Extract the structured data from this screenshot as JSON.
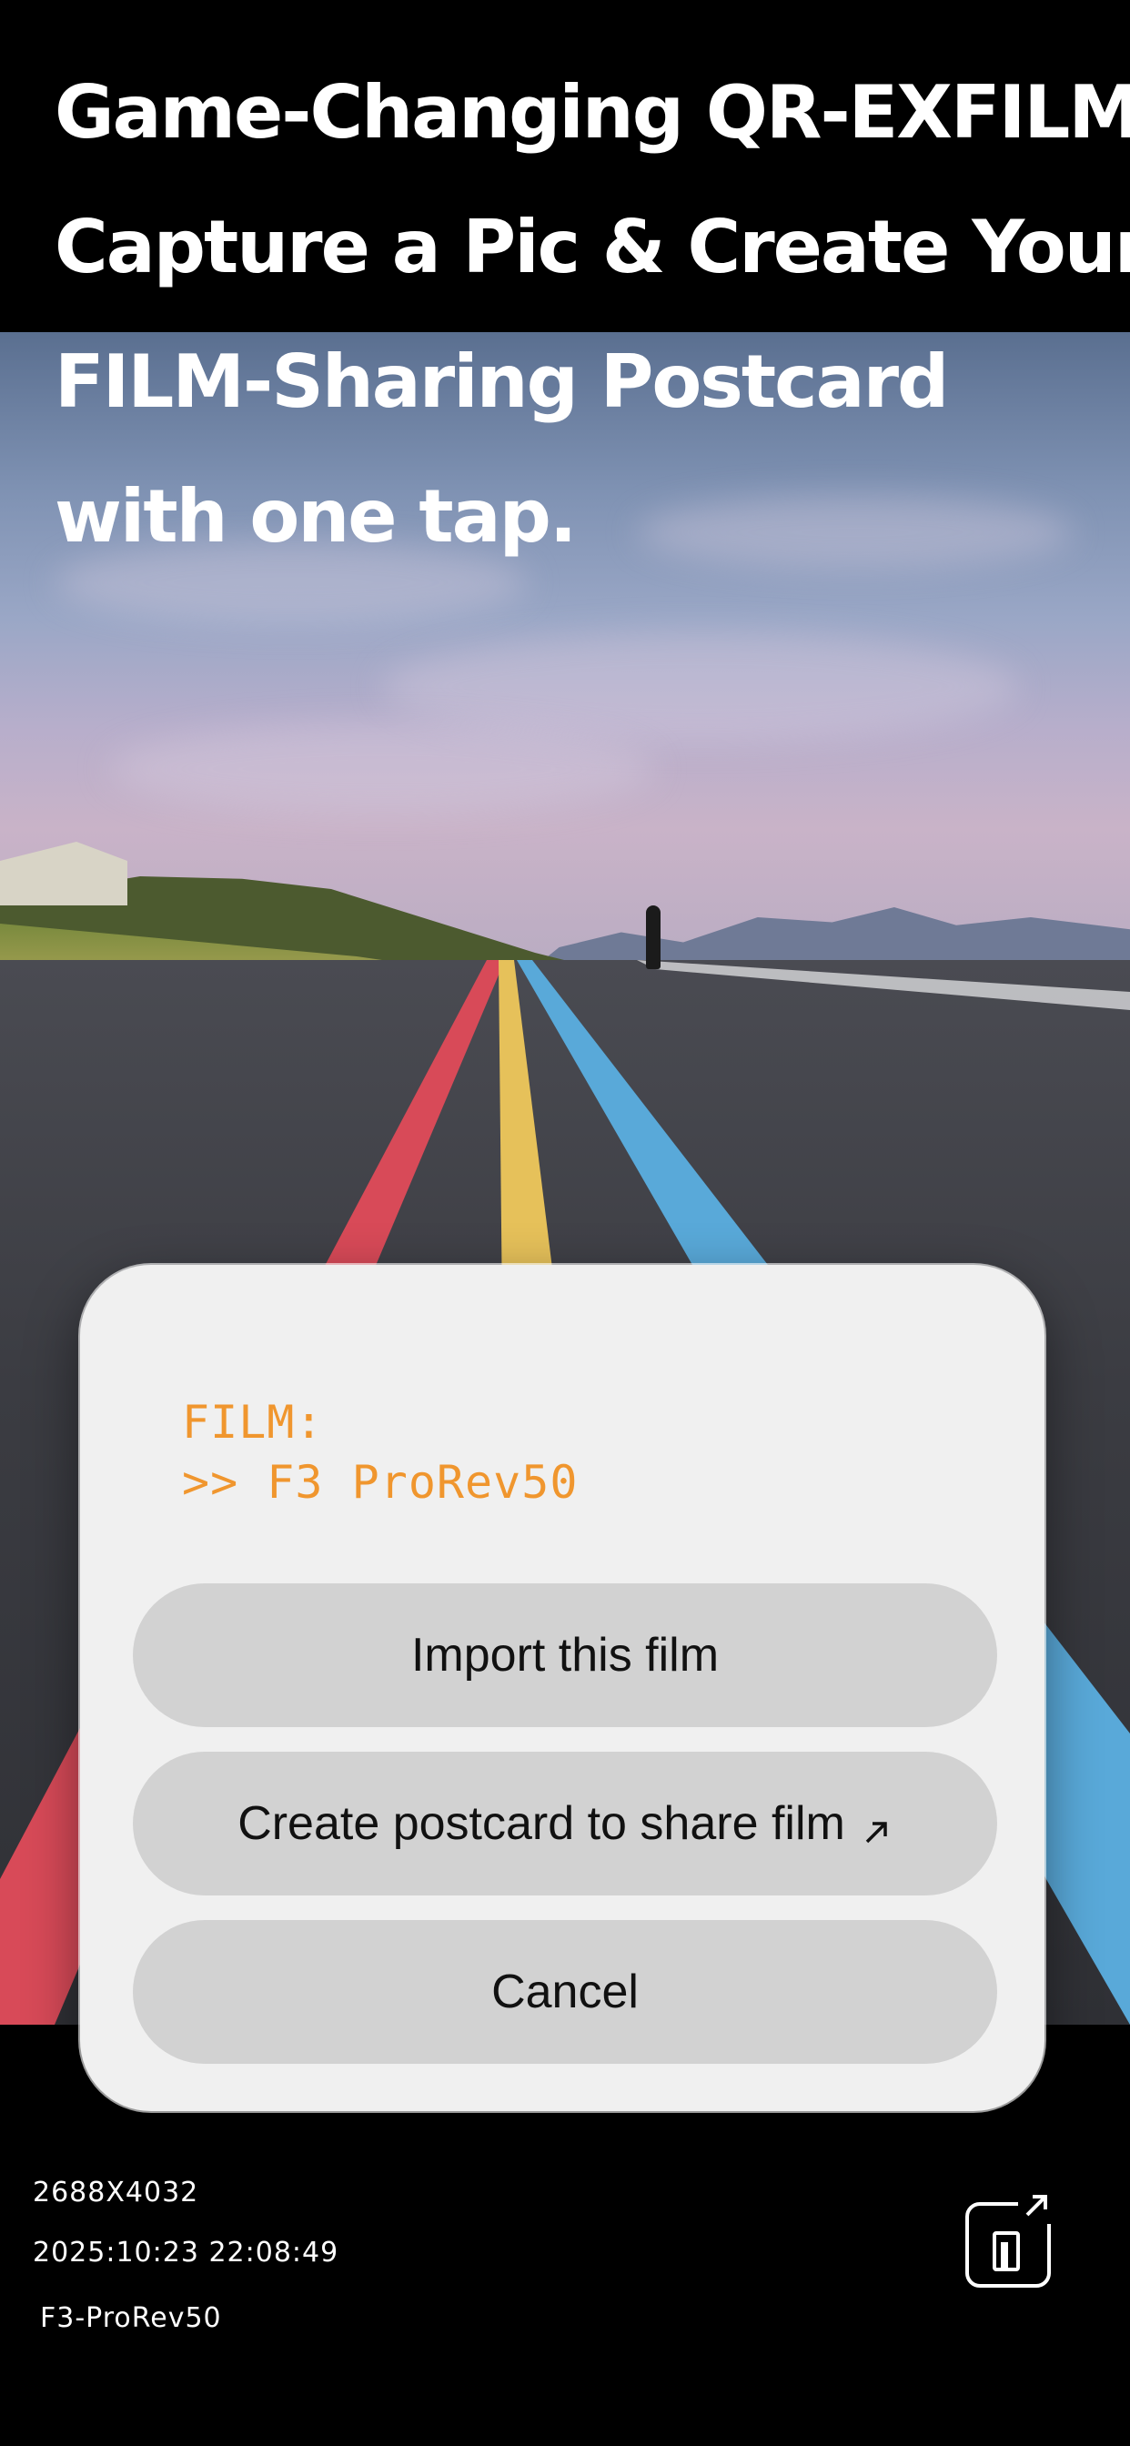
{
  "headline": {
    "line1": "Game-Changing QR-EXFILM™",
    "line2": "Capture a Pic & Create Your",
    "line3": "FILM-Sharing Postcard",
    "line4": "with one tap."
  },
  "dialog": {
    "film_label": "FILM:",
    "film_value": ">> F3 ProRev50",
    "import_label": "Import this film",
    "postcard_label": "Create postcard to share film",
    "postcard_icon": "external-arrow-icon",
    "cancel_label": "Cancel"
  },
  "photo_info": {
    "resolution": "2688X4032",
    "datetime": "2025:10:23 22:08:49",
    "film": "F3-ProRev50"
  },
  "share_button": {
    "icon": "film-share-icon"
  },
  "colors": {
    "accent_orange": "#f0962e",
    "dialog_bg": "#f0f0f0",
    "button_bg": "#d2d2d2"
  }
}
